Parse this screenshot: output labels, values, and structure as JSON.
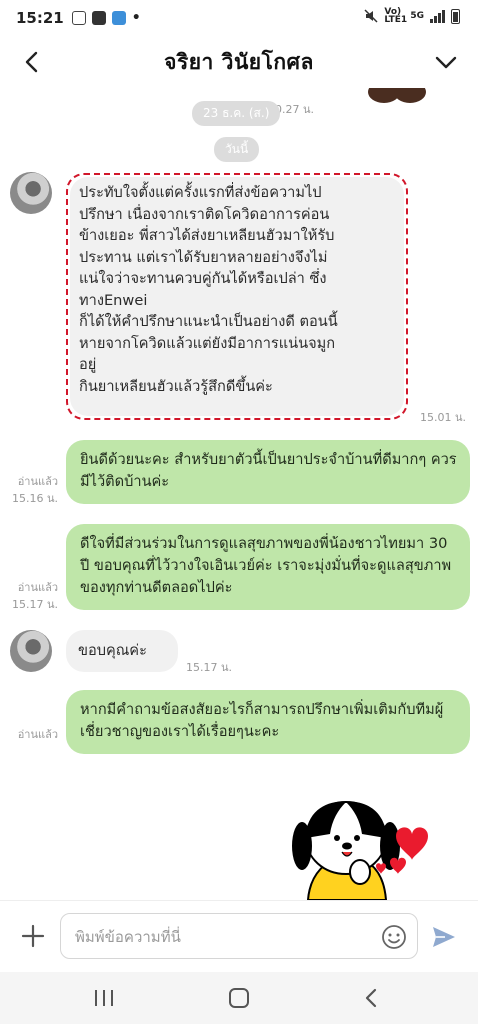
{
  "status": {
    "time": "15:21",
    "dot": "•",
    "network_label": "Vo) LTE1",
    "network_gen": "5G"
  },
  "header": {
    "title": "จริยา วินัยโกศล"
  },
  "chat": {
    "partial_time": "10.27 น.",
    "date_pill_old": "23 ธ.ค. (ส.)",
    "date_pill_today": "วันนี้",
    "messages": [
      {
        "direction": "in",
        "lines": [
          "ประทับใจตั้งแต่ครั้งแรกที่ส่งข้อความไป",
          "ปรึกษา เนื่องจากเราติดโควิดอาการค่อน",
          "ข้างเยอะ พี่สาวได้ส่งยาเหลียนฮัวมาให้รับ",
          "ประทาน แต่เราได้รับยาหลายอย่างจึงไม่",
          "แน่ใจว่าจะทานควบคู่กันได้หรือเปล่า ซึ่ง",
          "ทางEnwei",
          "ก็ได้ให้คำปรึกษาแนะนำเป็นอย่างดี ตอนนี้",
          "หายจากโควิดแล้วแต่ยังมีอาการแน่นจมูก",
          "อยู่",
          "กินยาเหลียนฮัวแล้วรู้สึกดีขึ้นค่ะ"
        ],
        "time": "15.01 น."
      },
      {
        "direction": "out",
        "text": "ยินดีด้วยนะคะ สำหรับยาตัวนี้เป็นยาประจำบ้านที่ดีมากๆ ควรมีไว้ติดบ้านค่ะ",
        "read": "อ่านแล้ว",
        "time": "15.16 น."
      },
      {
        "direction": "out",
        "text": "ดีใจที่มีส่วนร่วมในการดูแลสุขภาพของพี่น้องชาวไทยมา 30 ปี ขอบคุณที่ไว้วางใจเอินเวย์ค่ะ เราจะมุ่งมั่นที่จะดูแลสุขภาพของทุกท่านดีตลอดไปค่ะ",
        "read": "อ่านแล้ว",
        "time": "15.17 น."
      },
      {
        "direction": "in",
        "text": "ขอบคุณค่ะ",
        "time": "15.17 น."
      },
      {
        "direction": "out",
        "text": "หากมีคำถามข้อสงสัยอะไรก็สามารถปรึกษาเพิ่มเติมกับทีมผู้เชี่ยวชาญของเราได้เรื่อยๆนะคะ",
        "read": "อ่านแล้ว"
      }
    ]
  },
  "input": {
    "placeholder": "พิมพ์ข้อความที่นี่"
  },
  "colors": {
    "outgoing_bubble": "#bfe6a9",
    "incoming_bubble": "#f1f1f1",
    "highlight": "#d1162a",
    "send": "#8fa9cf"
  },
  "icons": [
    "back-arrow-icon",
    "chevron-down-icon",
    "plus-icon",
    "emoji-icon",
    "send-icon",
    "recent-apps-icon",
    "home-icon",
    "back-nav-icon"
  ]
}
